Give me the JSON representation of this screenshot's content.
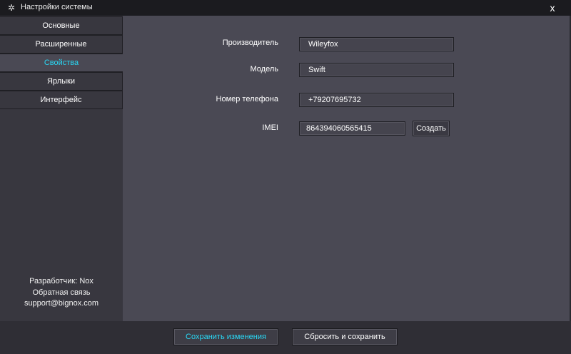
{
  "window": {
    "title": "Настройки системы",
    "close_label": "x"
  },
  "sidebar": {
    "items": [
      {
        "label": "Основные"
      },
      {
        "label": "Расширенные"
      },
      {
        "label": "Свойства",
        "active": true
      },
      {
        "label": "Ярлыки"
      },
      {
        "label": "Интерфейс"
      }
    ],
    "info": {
      "developer": "Разработчик: Nox",
      "feedback": "Обратная связь",
      "email": "support@bignox.com"
    }
  },
  "form": {
    "manufacturer": {
      "label": "Производитель",
      "value": "Wileyfox"
    },
    "model": {
      "label": "Модель",
      "value": "Swift"
    },
    "phone": {
      "label": "Номер телефона",
      "value": "+79207695732"
    },
    "imei": {
      "label": "IMEI",
      "value": "864394060565415",
      "generate_label": "Создать"
    }
  },
  "footer": {
    "save_label": "Сохранить изменения",
    "reset_label": "Сбросить и сохранить"
  },
  "colors": {
    "accent": "#29d8f5",
    "main_bg": "#4a4954",
    "sidebar_bg": "#38373f",
    "titlebar_bg": "#1b1b1f"
  }
}
